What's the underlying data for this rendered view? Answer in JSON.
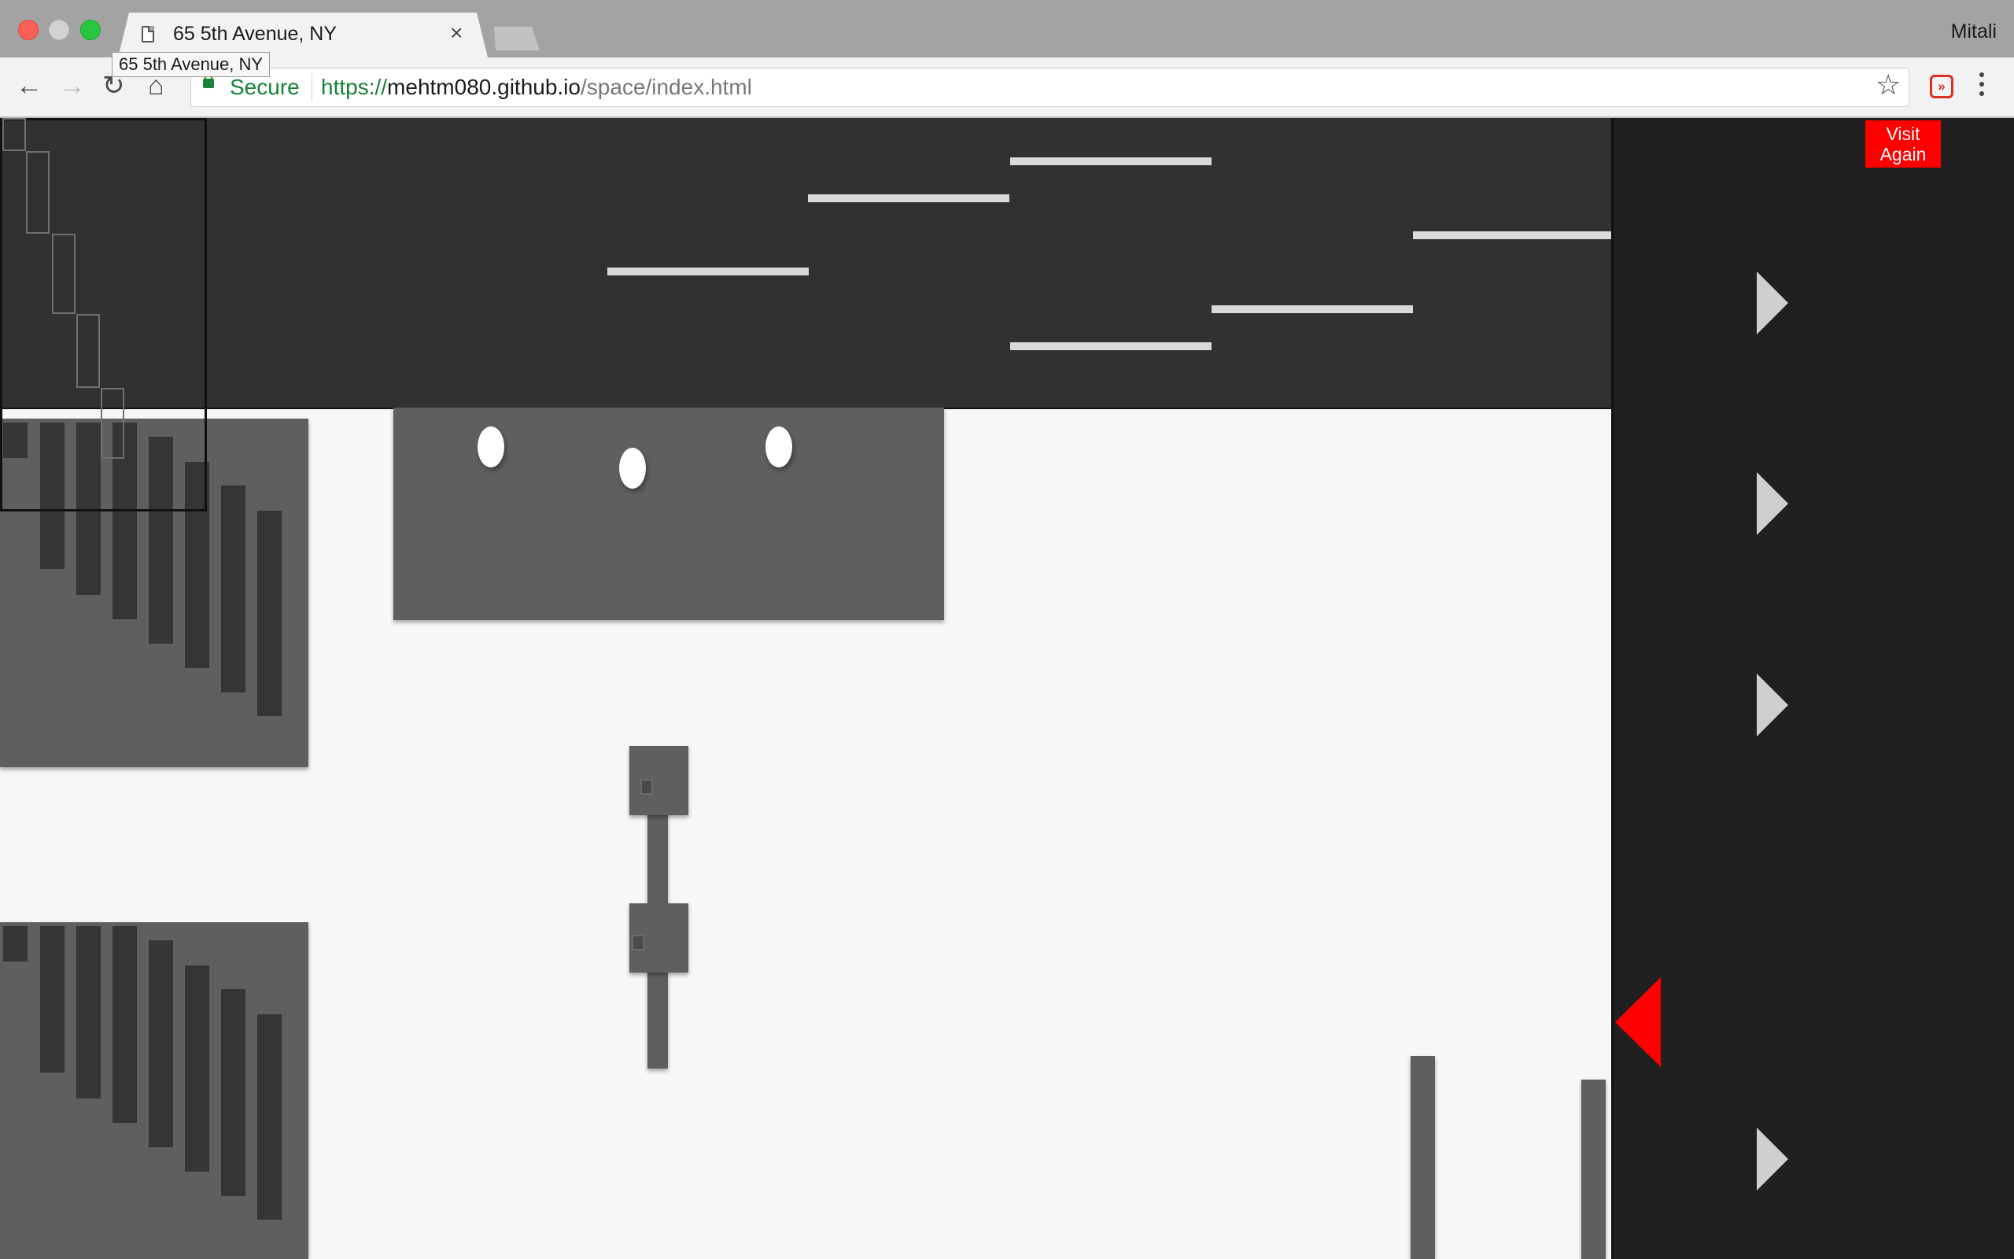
{
  "browser": {
    "tab_title": "65 5th Avenue, NY",
    "tab_tooltip": "65 5th Avenue, NY",
    "profile_name": "Mitali",
    "security_label": "Secure",
    "url_scheme": "https://",
    "url_host": "mehtm080.github.io",
    "url_path": "/space/index.html",
    "icons": {
      "back": "arrow-left-icon",
      "forward": "arrow-right-icon",
      "reload": "reload-icon",
      "home": "home-icon",
      "bookmark": "star-icon",
      "extension": "fast-forward-extension-icon",
      "menu": "vertical-dots-icon",
      "tab_page": "document-icon",
      "tab_close": "close-icon"
    }
  },
  "page": {
    "visit_again_label": "Visit Again",
    "colors": {
      "accent": "#ff0000",
      "sidebar_bg": "#202020",
      "band_bg": "#303133",
      "floor_bg": "#f7f7f7",
      "block": "#5f5f5f"
    },
    "sidebar_controls": [
      {
        "icon": "play-arrow-right-icon",
        "state": "inactive"
      },
      {
        "icon": "play-arrow-right-icon",
        "state": "inactive"
      },
      {
        "icon": "play-arrow-right-icon",
        "state": "inactive"
      },
      {
        "icon": "play-arrow-left-icon",
        "state": "active"
      },
      {
        "icon": "play-arrow-right-icon",
        "state": "inactive"
      }
    ]
  }
}
